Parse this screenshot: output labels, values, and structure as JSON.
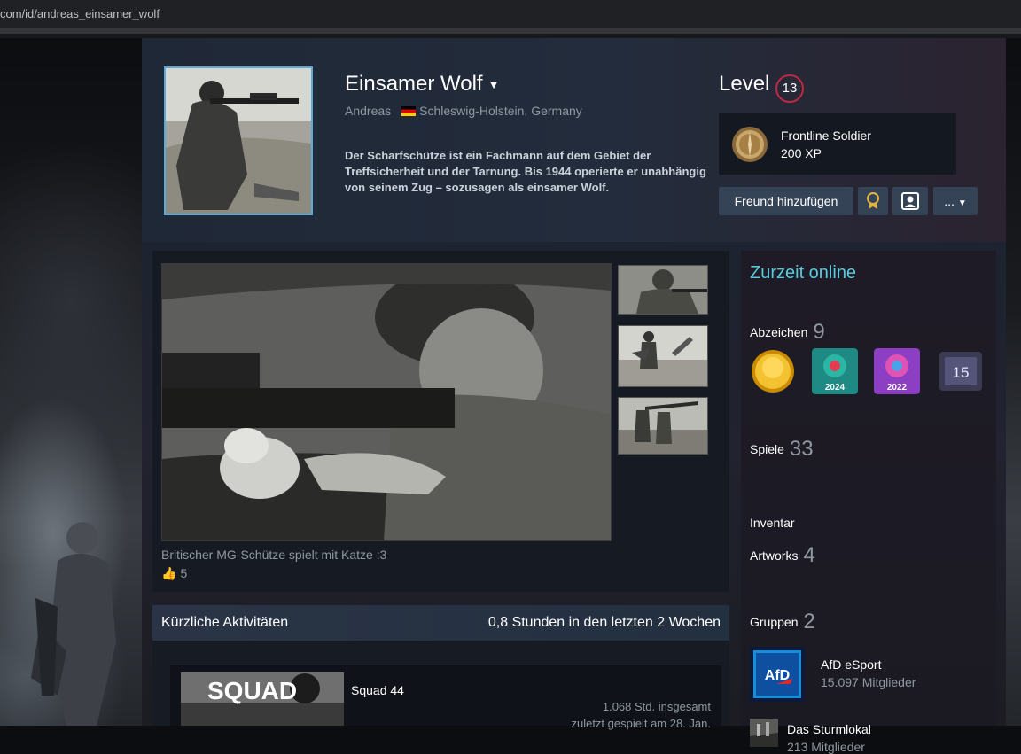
{
  "browser": {
    "url": "com/id/andreas_einsamer_wolf"
  },
  "profile": {
    "persona_name": "Einsamer Wolf",
    "real_name": "Andreas",
    "location": "Schleswig-Holstein, Germany",
    "summary": "Der Scharfschütze ist ein Fachmann auf dem Gebiet der Treffsicherheit und der Tarnung. Bis 1944 operierte er unabhängig von seinem Zug – sozusagen als einsamer Wolf."
  },
  "level": {
    "label": "Level",
    "value": "13"
  },
  "xp_badge": {
    "title": "Frontline Soldier",
    "xp": "200 XP"
  },
  "buttons": {
    "add_friend": "Freund hinzufügen",
    "more": "..."
  },
  "showcase": {
    "caption": "Britischer MG-Schütze spielt mit Katze :3",
    "likes": "5"
  },
  "recent": {
    "title": "Kürzliche Aktivitäten",
    "hours": "0,8 Stunden in den letzten 2 Wochen",
    "game": {
      "name": "Squad 44",
      "capsule_text": "SQUAD",
      "total": "1.068 Std. insgesamt",
      "last_played": "zuletzt gespielt am 28. Jan."
    }
  },
  "sidebar": {
    "status": "Zurzeit online",
    "badges": {
      "label": "Abzeichen",
      "count": "9",
      "items": [
        "gold-coin",
        "steam-2024",
        "steam-2022",
        "years-15"
      ],
      "badge_texts": [
        "2024",
        "2022",
        "15"
      ]
    },
    "games": {
      "label": "Spiele",
      "count": "33"
    },
    "inventory": {
      "label": "Inventar"
    },
    "artwork": {
      "label": "Artworks",
      "count": "4"
    },
    "groups": {
      "label": "Gruppen",
      "count": "2",
      "items": [
        {
          "name": "AfD eSport",
          "members": "15.097 Mitglieder",
          "logo_text": "AfD"
        },
        {
          "name": "Das Sturmlokal",
          "members": "213 Mitglieder"
        }
      ]
    }
  },
  "colors": {
    "accent": "#66c0f4",
    "online": "#57cbde",
    "level_ring": "#c02942"
  }
}
